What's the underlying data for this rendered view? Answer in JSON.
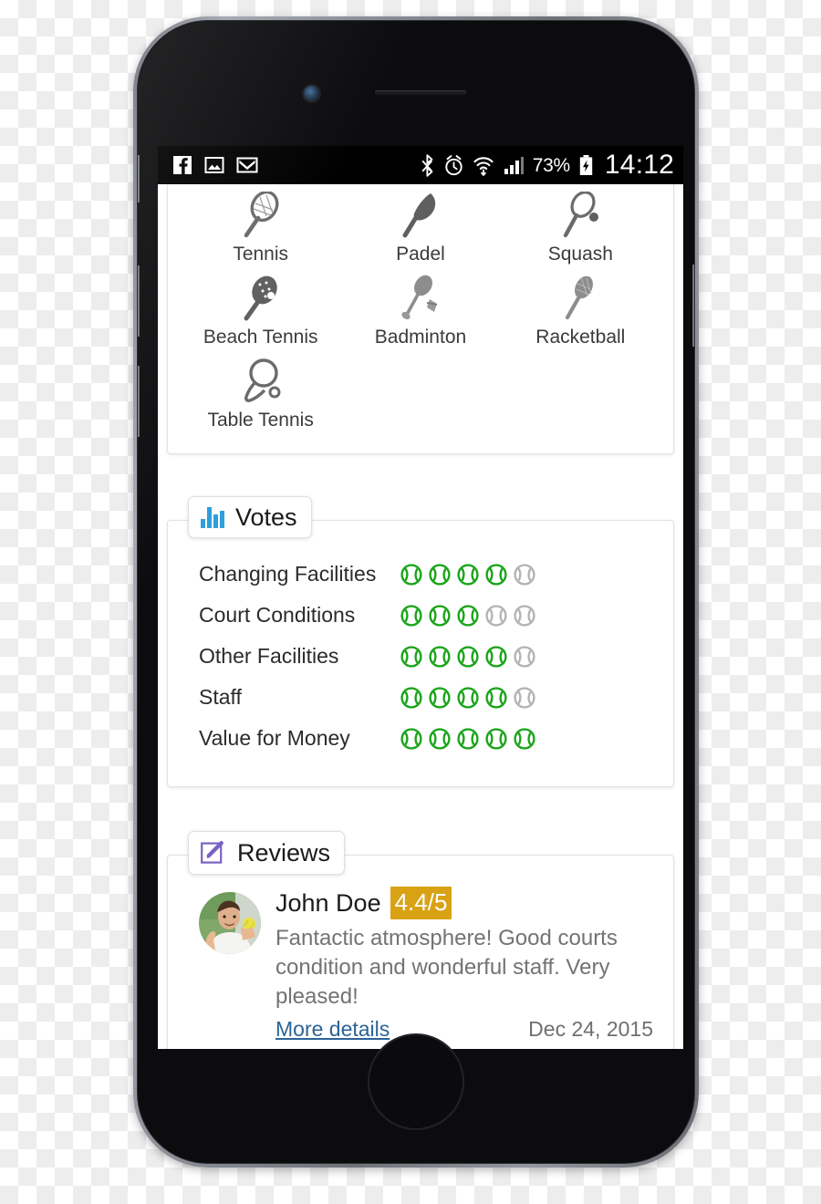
{
  "status_bar": {
    "left_icons": [
      "facebook-icon",
      "image-icon",
      "gmail-icon"
    ],
    "right_icons": [
      "bluetooth-icon",
      "alarm-icon",
      "wifi-icon",
      "signal-icon"
    ],
    "battery_percent": "73%",
    "battery_state": "charging",
    "clock": "14:12"
  },
  "sports": {
    "items": [
      {
        "label": "Tennis",
        "icon": "tennis-racket-icon"
      },
      {
        "label": "Padel",
        "icon": "padel-racket-icon"
      },
      {
        "label": "Squash",
        "icon": "squash-racket-icon"
      },
      {
        "label": "Beach Tennis",
        "icon": "beach-tennis-racket-icon"
      },
      {
        "label": "Badminton",
        "icon": "badminton-racket-icon"
      },
      {
        "label": "Racketball",
        "icon": "racketball-racket-icon"
      },
      {
        "label": "Table Tennis",
        "icon": "table-tennis-paddle-icon"
      }
    ]
  },
  "votes": {
    "title": "Votes",
    "icon": "bar-chart-icon",
    "max_rating": 5,
    "accent_color": "#2f9fdb",
    "filled_color": "#1aa51a",
    "empty_color": "#b4b4b4",
    "rows": [
      {
        "label": "Changing Facilities",
        "rating": 4
      },
      {
        "label": "Court Conditions",
        "rating": 3
      },
      {
        "label": "Other Facilities",
        "rating": 4
      },
      {
        "label": "Staff",
        "rating": 4
      },
      {
        "label": "Value for Money",
        "rating": 5
      }
    ]
  },
  "reviews": {
    "title": "Reviews",
    "icon": "edit-pencil-icon",
    "accent_color": "#7a62c4",
    "badge_color": "#d9a215",
    "items": [
      {
        "author": "John Doe",
        "rating_badge": "4.4/5",
        "text": "Fantactic atmosphere! Good courts condition and wonderful staff. Very pleased!",
        "more_label": "More details",
        "date": "Dec 24, 2015",
        "avatar": "user-photo-tennis-player"
      }
    ]
  }
}
